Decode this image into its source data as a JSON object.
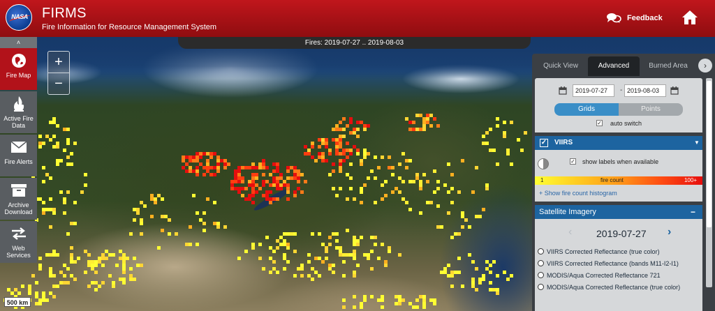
{
  "header": {
    "logo_text": "NASA",
    "title": "FIRMS",
    "subtitle": "Fire Information for Resource Management System",
    "feedback_label": "Feedback"
  },
  "map": {
    "fires_range": "Fires: 2019-07-27 .. 2019-08-03",
    "zoom_in": "+",
    "zoom_out": "−",
    "scale_label": "500 km"
  },
  "sidebar": {
    "collapse_glyph": "˄",
    "items": [
      {
        "label": "Fire Map",
        "icon": "fire-map-icon"
      },
      {
        "label": "Active Fire Data",
        "icon": "flame-icon"
      },
      {
        "label": "Fire Alerts",
        "icon": "envelope-icon"
      },
      {
        "label": "Archive Download",
        "icon": "archive-box-icon"
      },
      {
        "label": "Web Services",
        "icon": "exchange-arrows-icon"
      }
    ]
  },
  "panel": {
    "tabs": [
      "Quick View",
      "Advanced",
      "Burned Area"
    ],
    "active_tab": "Advanced",
    "next_tab_glyph": "›",
    "date_from": "2019-07-27",
    "date_to": "2019-08-03",
    "date_sep": "-",
    "view_modes": [
      "Grids",
      "Points"
    ],
    "active_mode": "Grids",
    "auto_switch_label": "auto switch",
    "auto_switch_checked": true,
    "layer_name": "VIIRS",
    "layer_checked": true,
    "dropdown_glyph": "▼",
    "show_labels_text": "show labels when available",
    "fire_count_low": "1",
    "fire_count_label": "fire count",
    "fire_count_high": "100+",
    "histogram_link": "+ Show fire count histogram",
    "satellite_title": "Satellite Imagery",
    "collapse_glyph": "−",
    "imagery_date": "2019-07-27",
    "prev_glyph": "‹",
    "next_glyph": "›",
    "imagery_options": [
      "VIIRS Corrected Reflectance (true color)",
      "VIIRS Corrected Reflectance (bands M11-I2-I1)",
      "MODIS/Aqua Corrected Reflectance 721",
      "MODIS/Aqua Corrected Reflectance (true color)"
    ]
  },
  "colors": {
    "header_red": "#b2121a",
    "accent_blue": "#1d64a0",
    "fire_low": "#ffff33",
    "fire_high": "#e60e0e"
  }
}
